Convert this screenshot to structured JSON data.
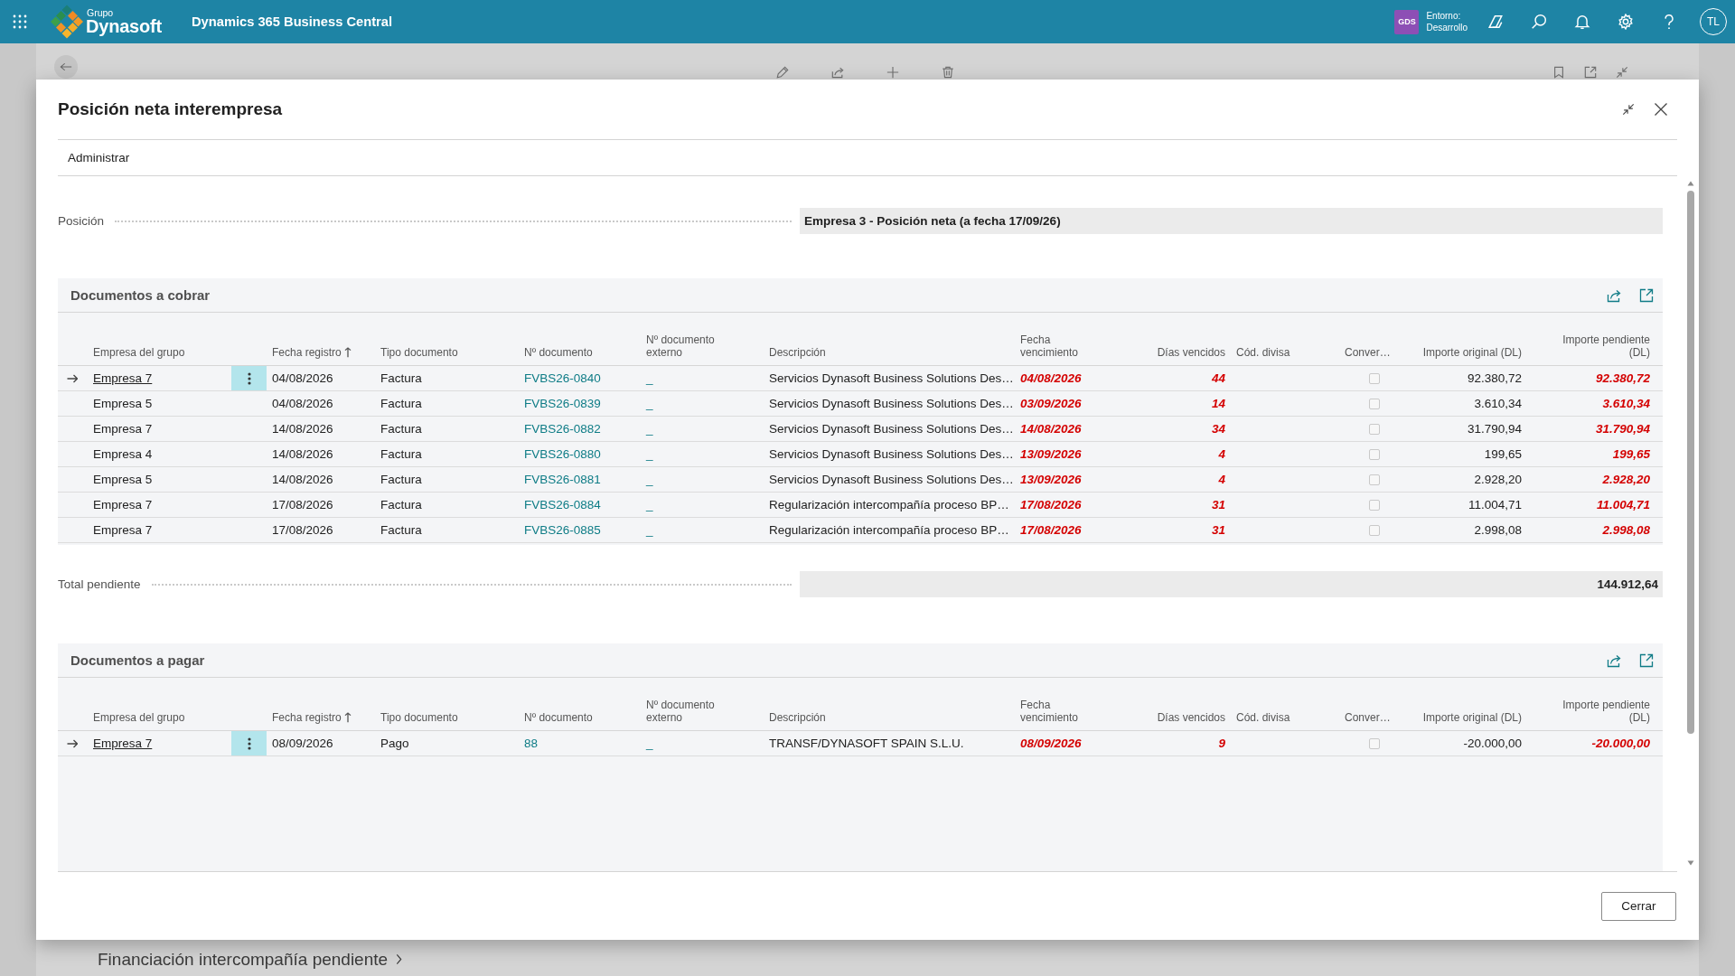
{
  "top_bar": {
    "logo_caption": "Grupo",
    "logo_text": "Dynasoft",
    "app_name": "Dynamics 365 Business Central",
    "environment_badge": "GDS",
    "environment_label": "Entorno:",
    "environment_name": "Desarrollo",
    "user_initials": "TL"
  },
  "dialog": {
    "title": "Posición neta interempresa",
    "menu": "Administrar",
    "position": {
      "label": "Posición",
      "value": "Empresa 3 - Posición neta (a fecha 17/09/26)"
    },
    "receivables": {
      "title": "Documentos a cobrar",
      "columns": [
        {
          "label": "Empresa del grupo",
          "sorted": false
        },
        {
          "label": "Fecha registro",
          "sorted": true
        },
        {
          "label": "Tipo documento",
          "sorted": false
        },
        {
          "label": "Nº documento",
          "sorted": false
        },
        {
          "label": "Nº documento externo",
          "sorted": false
        },
        {
          "label": "Descripción",
          "sorted": false
        },
        {
          "label": "Fecha vencimiento",
          "sorted": false
        },
        {
          "label": "Días vencidos",
          "sorted": false
        },
        {
          "label": "Cód. divisa",
          "sorted": false
        },
        {
          "label": "Conver…",
          "sorted": false
        },
        {
          "label": "Importe original (DL)",
          "sorted": false
        },
        {
          "label": "Importe pendiente (DL)",
          "sorted": false
        }
      ],
      "rows": [
        {
          "company": "Empresa 7",
          "posting_date": "04/08/2026",
          "document_type": "Factura",
          "document_no": "FVBS26-0840",
          "external_document_no": "_",
          "description": "Servicios Dynasoft Business Solutions Des…",
          "due_date": "04/08/2026",
          "days_overdue": "44",
          "conver_checked": false,
          "original_amount": "92.380,72",
          "remaining_amount": "92.380,72",
          "overdue": true,
          "selected": true
        },
        {
          "company": "Empresa 5",
          "posting_date": "04/08/2026",
          "document_type": "Factura",
          "document_no": "FVBS26-0839",
          "external_document_no": "_",
          "description": "Servicios Dynasoft Business Solutions Des…",
          "due_date": "03/09/2026",
          "days_overdue": "14",
          "conver_checked": false,
          "original_amount": "3.610,34",
          "remaining_amount": "3.610,34",
          "overdue": true,
          "selected": false
        },
        {
          "company": "Empresa 7",
          "posting_date": "14/08/2026",
          "document_type": "Factura",
          "document_no": "FVBS26-0882",
          "external_document_no": "_",
          "description": "Servicios Dynasoft Business Solutions Des…",
          "due_date": "14/08/2026",
          "days_overdue": "34",
          "conver_checked": false,
          "original_amount": "31.790,94",
          "remaining_amount": "31.790,94",
          "overdue": true,
          "selected": false
        },
        {
          "company": "Empresa 4",
          "posting_date": "14/08/2026",
          "document_type": "Factura",
          "document_no": "FVBS26-0880",
          "external_document_no": "_",
          "description": "Servicios Dynasoft Business Solutions Des…",
          "due_date": "13/09/2026",
          "days_overdue": "4",
          "conver_checked": false,
          "original_amount": "199,65",
          "remaining_amount": "199,65",
          "overdue": true,
          "selected": false
        },
        {
          "company": "Empresa 5",
          "posting_date": "14/08/2026",
          "document_type": "Factura",
          "document_no": "FVBS26-0881",
          "external_document_no": "_",
          "description": "Servicios Dynasoft Business Solutions Des…",
          "due_date": "13/09/2026",
          "days_overdue": "4",
          "conver_checked": false,
          "original_amount": "2.928,20",
          "remaining_amount": "2.928,20",
          "overdue": true,
          "selected": false
        },
        {
          "company": "Empresa 7",
          "posting_date": "17/08/2026",
          "document_type": "Factura",
          "document_no": "FVBS26-0884",
          "external_document_no": "_",
          "description": "Regularización intercompañía proceso BP…",
          "due_date": "17/08/2026",
          "days_overdue": "31",
          "conver_checked": false,
          "original_amount": "11.004,71",
          "remaining_amount": "11.004,71",
          "overdue": true,
          "selected": false
        },
        {
          "company": "Empresa 7",
          "posting_date": "17/08/2026",
          "document_type": "Factura",
          "document_no": "FVBS26-0885",
          "external_document_no": "_",
          "description": "Regularización intercompañía proceso BP…",
          "due_date": "17/08/2026",
          "days_overdue": "31",
          "conver_checked": false,
          "original_amount": "2.998,08",
          "remaining_amount": "2.998,08",
          "overdue": true,
          "selected": false
        }
      ]
    },
    "total_pending": {
      "label": "Total pendiente",
      "value": "144.912,64"
    },
    "payables": {
      "title": "Documentos a pagar",
      "columns": [
        {
          "label": "Empresa del grupo",
          "sorted": false
        },
        {
          "label": "Fecha registro",
          "sorted": true
        },
        {
          "label": "Tipo documento",
          "sorted": false
        },
        {
          "label": "Nº documento",
          "sorted": false
        },
        {
          "label": "Nº documento externo",
          "sorted": false
        },
        {
          "label": "Descripción",
          "sorted": false
        },
        {
          "label": "Fecha vencimiento",
          "sorted": false
        },
        {
          "label": "Días vencidos",
          "sorted": false
        },
        {
          "label": "Cód. divisa",
          "sorted": false
        },
        {
          "label": "Conver…",
          "sorted": false
        },
        {
          "label": "Importe original (DL)",
          "sorted": false
        },
        {
          "label": "Importe pendiente (DL)",
          "sorted": false
        }
      ],
      "rows": [
        {
          "company": "Empresa 7",
          "posting_date": "08/09/2026",
          "document_type": "Pago",
          "document_no": "88",
          "external_document_no": "_",
          "description": "TRANSF/DYNASOFT SPAIN S.L.U.",
          "due_date": "08/09/2026",
          "days_overdue": "9",
          "conver_checked": false,
          "original_amount": "-20.000,00",
          "remaining_amount": "-20.000,00",
          "overdue": true,
          "selected": true
        }
      ]
    },
    "close_button": "Cerrar"
  },
  "background_page": {
    "link": "Financiación intercompañía pendiente"
  }
}
